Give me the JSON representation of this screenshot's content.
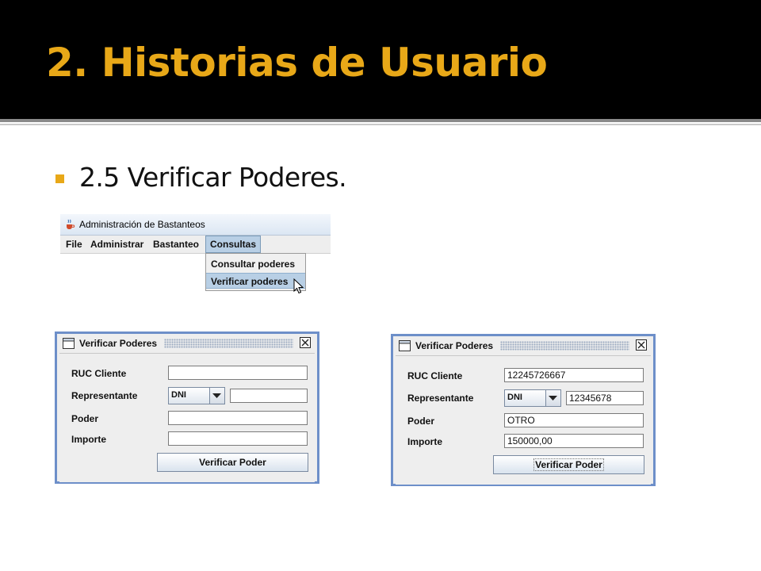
{
  "slide": {
    "title": "2. Historias de Usuario",
    "bullet": "2.5 Verificar Poderes.",
    "accent_color": "#e8a818"
  },
  "app_window": {
    "title": "Administración de Bastanteos",
    "icon": "java-cup-icon",
    "menu": [
      "File",
      "Administrar",
      "Bastanteo",
      "Consultas"
    ],
    "active_menu": "Consultas",
    "dropdown_items": [
      "Consultar poderes",
      "Verificar poderes"
    ],
    "highlighted_item": "Verificar poderes"
  },
  "dialog_empty": {
    "title": "Verificar Poderes",
    "labels": {
      "ruc": "RUC Cliente",
      "representante": "Representante",
      "poder": "Poder",
      "importe": "Importe"
    },
    "ruc_value": "",
    "doc_type": "DNI",
    "doc_number": "",
    "poder_value": "",
    "importe_value": "",
    "button_label": "Verificar Poder"
  },
  "dialog_filled": {
    "title": "Verificar Poderes",
    "labels": {
      "ruc": "RUC Cliente",
      "representante": "Representante",
      "poder": "Poder",
      "importe": "Importe"
    },
    "ruc_value": "12245726667",
    "doc_type": "DNI",
    "doc_number": "12345678",
    "poder_value": "OTRO",
    "importe_value": "150000,00",
    "button_label": "Verificar Poder"
  }
}
